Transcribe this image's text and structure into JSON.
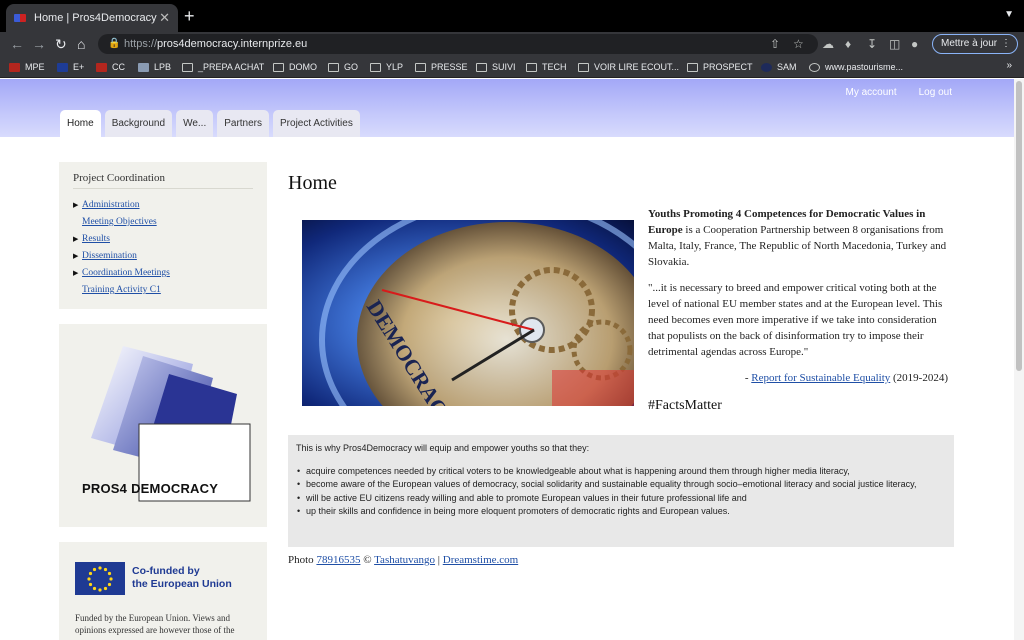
{
  "browser": {
    "tab_title": "Home | Pros4Democracy",
    "tab_close": "✕",
    "new_tab": "+",
    "url_scheme": "https://",
    "url_host": "pros4democracy.internprize.eu",
    "update_label": "Mettre à jour",
    "bookmarks": [
      "MPE",
      "E+",
      "CC",
      "LPB",
      "_PREPA ACHAT",
      "DOMO",
      "GO",
      "YLP",
      "PRESSE",
      "SUIVI",
      "TECH",
      "VOIR LIRE ECOUT...",
      "PROSPECT",
      "SAM",
      "www.pastourisme..."
    ],
    "bookmarks_more": "»"
  },
  "header": {
    "my_account": "My account",
    "log_out": "Log out",
    "tabs": [
      "Home",
      "Background",
      "We...",
      "Partners",
      "Project Activities"
    ]
  },
  "sidebar": {
    "coord_title": "Project Coordination",
    "items": [
      "Administration",
      "Meeting Objectives",
      "Results",
      "Dissemination",
      "Coordination Meetings",
      "Training Activity C1"
    ],
    "logo_word1": "PROS4",
    "logo_word2": "DEMOCRACY",
    "eu_cofunded_line1": "Co-funded by",
    "eu_cofunded_line2": "the European Union",
    "eu_note": "Funded by the European Union. Views and opinions expressed are however those of the"
  },
  "main": {
    "title": "Home",
    "hero_word": "DEMOCRACY",
    "intro_bold": "Youths Promoting 4 Competences for Democratic Values in Europe",
    "intro_rest": " is a Cooperation Partnership between 8 organisations from Malta, Italy, France, The Republic of North Macedonia, Turkey and Slovakia.",
    "quote": "\"...it is necessary to breed and empower critical voting both at the level of national EU member states and at the European level. This need becomes even more imperative if we take into consideration that populists on the back of disinformation try to impose their detrimental agendas across Europe.\"",
    "source_prefix": "- ",
    "source_link": "Report for Sustainable Equality",
    "source_years": " (2019-2024)",
    "hashtag": "#FactsMatter",
    "why_intro": "This is why Pros4Democracy will equip and empower youths so that they:",
    "why_points": [
      "acquire competences needed by critical voters to be knowledgeable about what is happening around them through higher media literacy,",
      "become aware of the European values of democracy, social solidarity and sustainable equality through socio–emotional literacy and social justice literacy,",
      "will be active EU citizens ready willing and able to promote European values in their future professional life and",
      "up their skills and confidence in being more eloquent promoters of democratic rights and European values."
    ],
    "credit_prefix": "Photo ",
    "credit_id": "78916535",
    "credit_copy": " © ",
    "credit_author": "Tashatuvango",
    "credit_sep": " | ",
    "credit_site": "Dreamstime.com"
  }
}
